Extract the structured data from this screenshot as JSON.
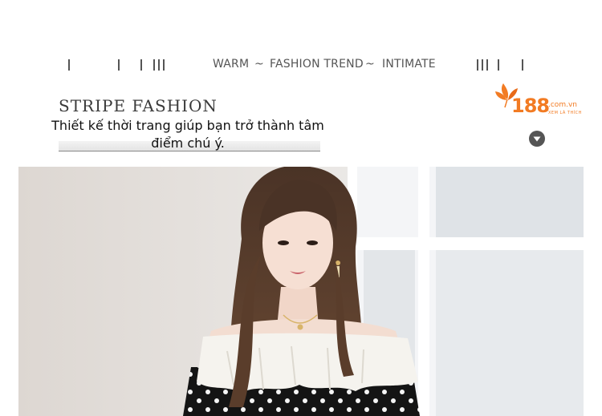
{
  "nav": {
    "left_word": "WARM",
    "sep1": "~",
    "center_word": "FASHION TREND",
    "sep2": "~",
    "right_word": "INTIMATE"
  },
  "title": "STRIPE FASHION",
  "tagline": "Thiết kế thời trang giúp bạn trở thành tâm điểm chú ý.",
  "logo": {
    "number": "188",
    "domain": ".com.vn",
    "tagline": "XEM LÀ THÍCH",
    "color": "#f27b23"
  },
  "icons": {
    "scroll_down": "chevron-down-circle-icon",
    "logo_leaf": "leaf-icon"
  },
  "photo": {
    "subject": "model-off-shoulder-polka-dot-top"
  }
}
